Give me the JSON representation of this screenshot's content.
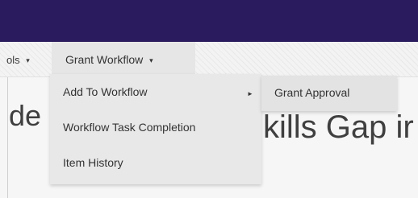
{
  "menubar": {
    "tools_label": "ols",
    "tools_caret": "▾",
    "grant_workflow_label": "Grant Workflow",
    "grant_workflow_caret": "▾"
  },
  "page": {
    "heading_left": "de",
    "heading_right": "kills Gap ir"
  },
  "dropdown": {
    "items": [
      {
        "label": "Add To Workflow",
        "submenu_arrow": "►"
      },
      {
        "label": "Workflow Task Completion"
      },
      {
        "label": "Item History"
      }
    ]
  },
  "submenu": {
    "items": [
      {
        "label": "Grant Approval"
      }
    ]
  },
  "colors": {
    "topbar": "#2a1a5e",
    "menubar": "#f3f3f3",
    "dropdown_bg": "#e8e8e8",
    "text": "#333333"
  }
}
